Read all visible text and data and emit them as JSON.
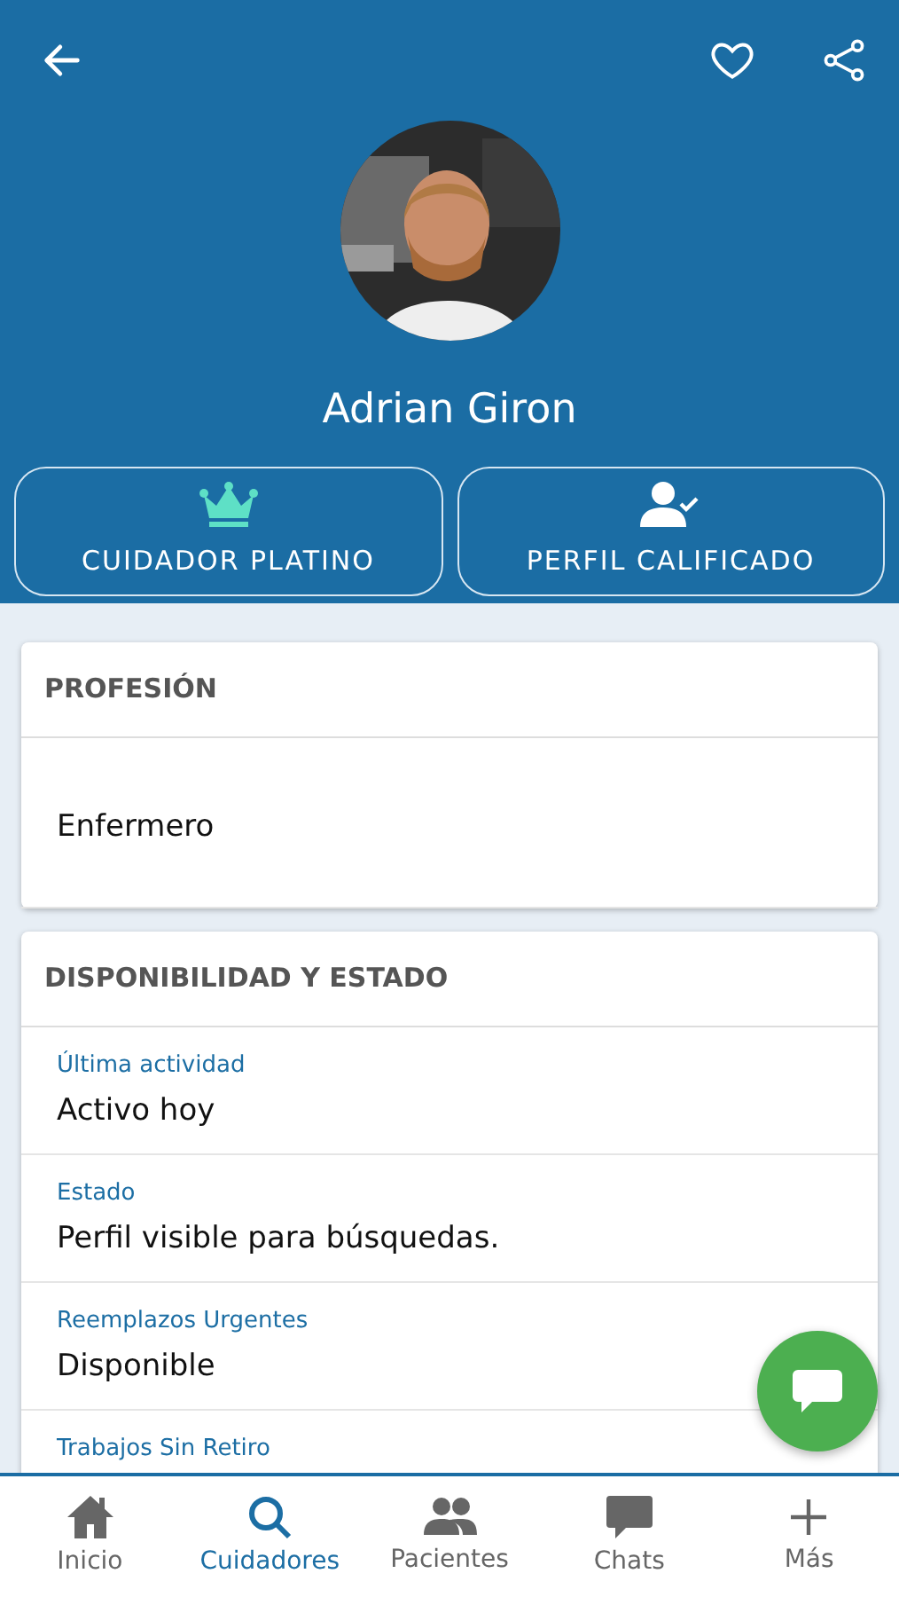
{
  "header": {
    "name": "Adrian Giron",
    "badges": [
      {
        "kind": "crown",
        "label": "CUIDADOR PLATINO"
      },
      {
        "kind": "verified",
        "label": "PERFIL CALIFICADO"
      }
    ]
  },
  "sections": [
    {
      "title": "PROFESIÓN",
      "rows": [
        {
          "value": "Enfermero"
        }
      ]
    },
    {
      "title": "DISPONIBILIDAD Y ESTADO",
      "rows": [
        {
          "label": "Última actividad",
          "value": "Activo hoy"
        },
        {
          "label": "Estado",
          "value": "Perfil visible para búsquedas."
        },
        {
          "label": "Reemplazos Urgentes",
          "value": "Disponible"
        },
        {
          "label": "Trabajos Sin Retiro"
        }
      ]
    }
  ],
  "bottom_nav": [
    {
      "kind": "home",
      "label": "Inicio",
      "selected": false
    },
    {
      "kind": "search",
      "label": "Cuidadores",
      "selected": true
    },
    {
      "kind": "people",
      "label": "Pacientes",
      "selected": false
    },
    {
      "kind": "chat",
      "label": "Chats",
      "selected": false
    },
    {
      "kind": "plus",
      "label": "Más",
      "selected": false
    }
  ]
}
